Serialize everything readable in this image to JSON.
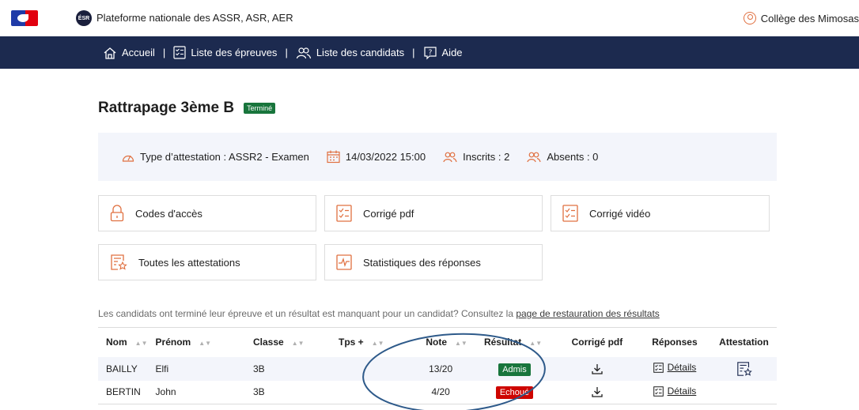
{
  "header": {
    "site_title": "Plateforme nationale des ASSR, ASR, AER",
    "logo_text": "ÉSR",
    "school_name": "Collège des Mimosas"
  },
  "nav": {
    "items": [
      {
        "label": "Accueil",
        "icon": "home-icon"
      },
      {
        "label": "Liste des épreuves",
        "icon": "checklist-icon"
      },
      {
        "label": "Liste des candidats",
        "icon": "users-icon"
      },
      {
        "label": "Aide",
        "icon": "help-icon"
      }
    ],
    "separator": "|"
  },
  "page": {
    "title": "Rattrapage 3ème B",
    "status": "Terminé"
  },
  "info": {
    "type": "Type d’attestation : ASSR2 - Examen",
    "date": "14/03/2022 15:00",
    "inscrits": "Inscrits : 2",
    "absents": "Absents : 0"
  },
  "tiles": {
    "codes": "Codes d'accès",
    "corrige_pdf": "Corrigé pdf",
    "corrige_video": "Corrigé vidéo",
    "attestations": "Toutes les attestations",
    "statistiques": "Statistiques des réponses"
  },
  "restore": {
    "text": "Les candidats ont terminé leur épreuve et un résultat est manquant pour un candidat? Consultez la ",
    "link": "page de restauration des résultats"
  },
  "table": {
    "headers": {
      "nom": "Nom",
      "prenom": "Prénom",
      "classe": "Classe",
      "tps": "Tps +",
      "note": "Note",
      "resultat": "Résultat",
      "corrige": "Corrigé pdf",
      "reponses": "Réponses",
      "attestation": "Attestation"
    },
    "rows": [
      {
        "nom": "BAILLY",
        "prenom": "Elfi",
        "classe": "3B",
        "tps": "",
        "note": "13/20",
        "resultat": "Admis",
        "details": "Détails"
      },
      {
        "nom": "BERTIN",
        "prenom": "John",
        "classe": "3B",
        "tps": "",
        "note": "4/20",
        "resultat": "Echoué",
        "details": "Détails"
      }
    ]
  },
  "colors": {
    "navbar": "#1c2a4f",
    "accent_orange": "#e07040",
    "success": "#18753c",
    "error": "#ce0500",
    "annotation": "#2e5a8a"
  }
}
